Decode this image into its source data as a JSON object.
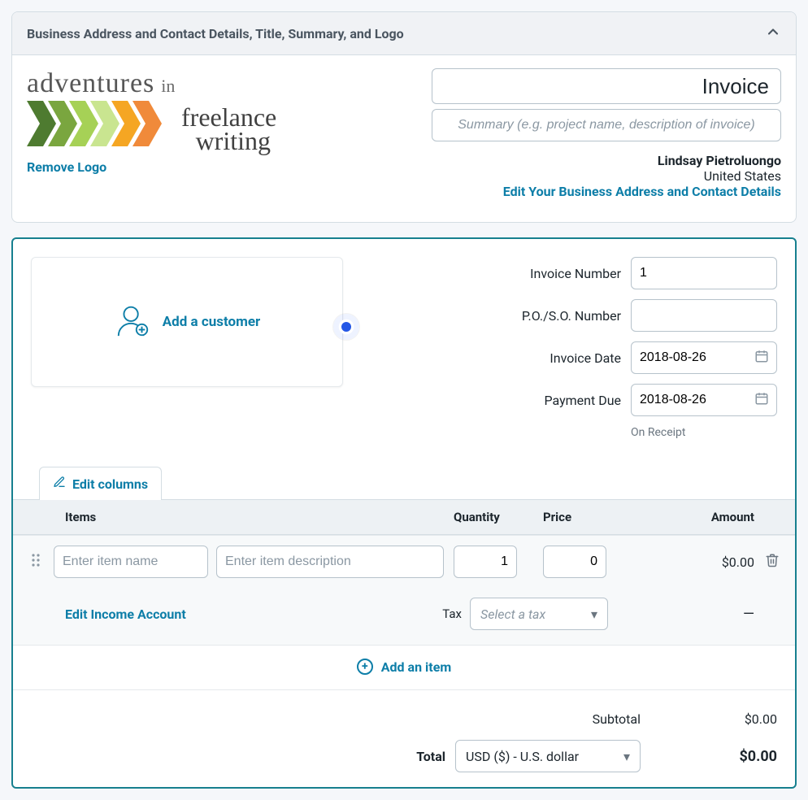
{
  "accordion": {
    "title": "Business Address and Contact Details, Title, Summary, and Logo",
    "remove_logo": "Remove Logo"
  },
  "business": {
    "title_value": "Invoice",
    "summary_placeholder": "Summary (e.g. project name, description of invoice)",
    "name": "Lindsay Pietroluongo",
    "location": "United States",
    "edit_link": "Edit Your Business Address and Contact Details"
  },
  "logo": {
    "word1": "adventures",
    "word2": "in",
    "script1": "freelance",
    "script2": "writing",
    "chevron_colors": [
      "#4e7b30",
      "#7aa63f",
      "#a6d156",
      "#c9e590",
      "#f5a623",
      "#f08a3a"
    ]
  },
  "customer": {
    "add_label": "Add a customer"
  },
  "meta": {
    "invoice_number_label": "Invoice Number",
    "invoice_number_value": "1",
    "po_label": "P.O./S.O. Number",
    "po_value": "",
    "invoice_date_label": "Invoice Date",
    "invoice_date_value": "2018-08-26",
    "payment_due_label": "Payment Due",
    "payment_due_value": "2018-08-26",
    "payment_due_hint": "On Receipt"
  },
  "edit_columns_label": "Edit columns",
  "table": {
    "headers": {
      "items": "Items",
      "qty": "Quantity",
      "price": "Price",
      "amount": "Amount"
    },
    "rows": [
      {
        "name_placeholder": "Enter item name",
        "name_value": "",
        "desc_placeholder": "Enter item description",
        "desc_value": "",
        "qty": "1",
        "price": "0",
        "amount": "$0.00"
      }
    ],
    "edit_income_label": "Edit Income Account",
    "tax_label": "Tax",
    "tax_placeholder": "Select a tax",
    "tax_amount": "—",
    "add_item_label": "Add an item"
  },
  "totals": {
    "subtotal_label": "Subtotal",
    "subtotal_value": "$0.00",
    "total_label": "Total",
    "currency_display": "USD ($) - U.S. dollar",
    "total_value": "$0.00"
  }
}
